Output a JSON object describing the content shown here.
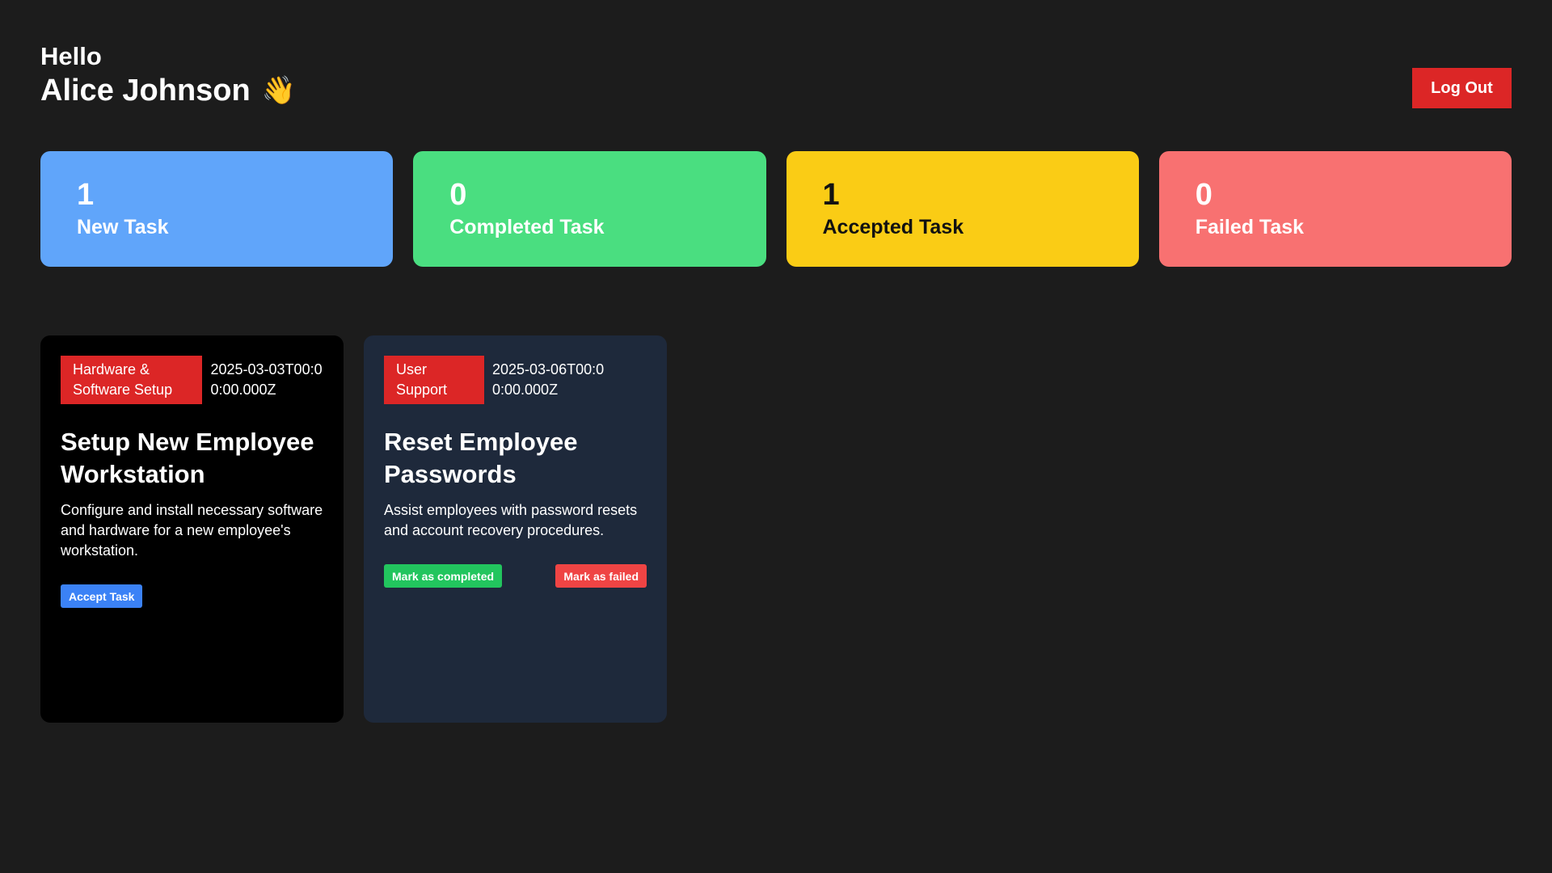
{
  "header": {
    "greeting": "Hello",
    "name": "Alice Johnson",
    "wave_icon": "👋",
    "logout_label": "Log Out"
  },
  "stats": [
    {
      "count": "1",
      "label": "New Task",
      "color": "#60a5fa"
    },
    {
      "count": "0",
      "label": "Completed Task",
      "color": "#4ade80"
    },
    {
      "count": "1",
      "label": "Accepted Task",
      "color": "#facc15"
    },
    {
      "count": "0",
      "label": "Failed Task",
      "color": "#f87171"
    }
  ],
  "tasks": [
    {
      "category": "Hardware & Software Setup",
      "date": "2025-03-03T00:00:00.000Z",
      "title": "Setup New Employee Workstation",
      "description": "Configure and install necessary software and hardware for a new employee's workstation.",
      "accept_label": "Accept Task",
      "background": "#000000"
    },
    {
      "category": "User Support",
      "date": "2025-03-06T00:00:00.000Z",
      "title": "Reset Employee Passwords",
      "description": "Assist employees with password resets and account recovery procedures.",
      "complete_label": "Mark as completed",
      "fail_label": "Mark as failed",
      "background": "#1e293b"
    }
  ],
  "colors": {
    "page_bg": "#1c1c1c",
    "danger": "#dc2626",
    "accept": "#3b82f6",
    "complete": "#22c55e",
    "fail": "#ef4444"
  }
}
